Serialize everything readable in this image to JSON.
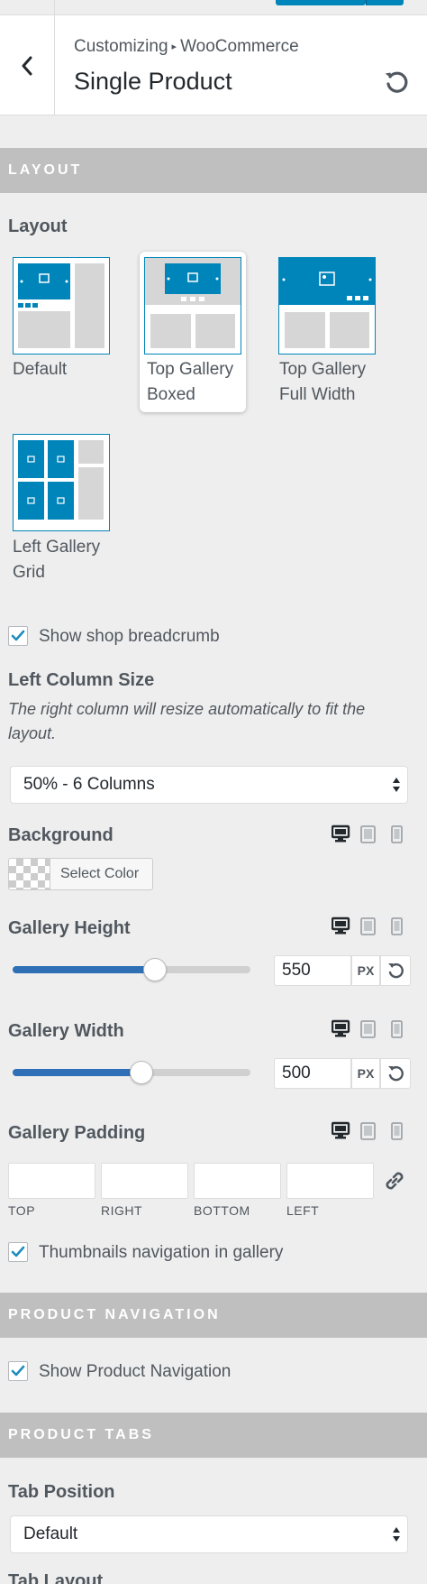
{
  "header": {
    "breadcrumb_parent": "Customizing",
    "breadcrumb_separator": "▸",
    "breadcrumb_child": "WooCommerce",
    "title": "Single Product"
  },
  "sections": {
    "layout": "LAYOUT",
    "product_navigation": "PRODUCT NAVIGATION",
    "product_tabs": "PRODUCT TABS"
  },
  "layout": {
    "label": "Layout",
    "options": [
      {
        "line1": "Default",
        "line2": ""
      },
      {
        "line1": "Top Gallery",
        "line2": "Boxed"
      },
      {
        "line1": "Top Gallery",
        "line2": "Full Width"
      },
      {
        "line1": "Left Gallery",
        "line2": "Grid"
      }
    ],
    "selected": "Top Gallery Boxed"
  },
  "breadcrumb_toggle": {
    "label": "Show shop breadcrumb",
    "checked": true
  },
  "left_column": {
    "label": "Left Column Size",
    "description": "The right column will resize automatically to fit the layout.",
    "value": "50% - 6 Columns"
  },
  "background": {
    "label": "Background",
    "button_label": "Select Color"
  },
  "gallery_height": {
    "label": "Gallery Height",
    "value": "550",
    "unit": "PX",
    "fraction": 0.6
  },
  "gallery_width": {
    "label": "Gallery Width",
    "value": "500",
    "unit": "PX",
    "fraction": 0.54
  },
  "gallery_padding": {
    "label": "Gallery Padding",
    "labels": [
      "TOP",
      "RIGHT",
      "BOTTOM",
      "LEFT"
    ]
  },
  "thumbnails_toggle": {
    "label": "Thumbnails navigation in gallery",
    "checked": true
  },
  "product_nav_toggle": {
    "label": "Show Product Navigation",
    "checked": true
  },
  "tab_position": {
    "label": "Tab Position",
    "value": "Default"
  },
  "tab_layout": {
    "label": "Tab Layout"
  },
  "colors": {
    "accent": "#0085ba",
    "slider": "#2e6fb5",
    "section_bg": "#bfbfbf"
  }
}
